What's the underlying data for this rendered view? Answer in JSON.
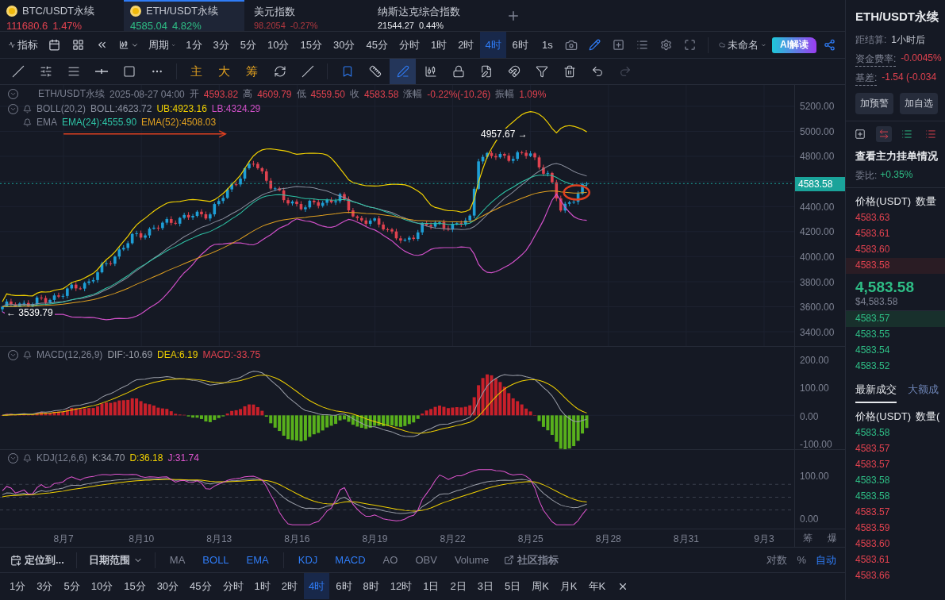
{
  "tabs": [
    {
      "symbol": "BTC/USDT永续",
      "price": "111680.6",
      "change": "1.47%",
      "color": "#e0424f",
      "kind": "crypto",
      "selected": false
    },
    {
      "symbol": "ETH/USDT永续",
      "price": "4585.04",
      "change": "4.82%",
      "color": "#2ebd85",
      "kind": "crypto",
      "selected": true
    },
    {
      "symbol": "美元指数",
      "price": "98.2054",
      "change": "-0.27%",
      "color": "#b0383f",
      "kind": "index",
      "selected": false
    },
    {
      "symbol": "纳斯达克综合指数",
      "price": "21544.27",
      "change": "0.44%",
      "color": "#e6e8ec",
      "kind": "index",
      "selected": false
    }
  ],
  "toolbar": {
    "indicator_label": "指标",
    "period_label": "周期",
    "periods": [
      {
        "label": "1分",
        "selected": false
      },
      {
        "label": "3分",
        "selected": false
      },
      {
        "label": "5分",
        "selected": false
      },
      {
        "label": "10分",
        "selected": false
      },
      {
        "label": "15分",
        "selected": false
      },
      {
        "label": "30分",
        "selected": false
      },
      {
        "label": "45分",
        "selected": false
      },
      {
        "label": "分时",
        "selected": false
      },
      {
        "label": "1时",
        "selected": false
      },
      {
        "label": "2时",
        "selected": false
      },
      {
        "label": "4时",
        "selected": true
      },
      {
        "label": "6时",
        "selected": false
      }
    ],
    "seconds": "1s",
    "layout_name": "未命名",
    "ai_label": "AI解读"
  },
  "drawing_tool_groups": [
    [
      {
        "kind": "trend-line",
        "selected": false
      },
      {
        "kind": "parallel",
        "selected": false
      },
      {
        "kind": "channel",
        "selected": false
      },
      {
        "kind": "horizontal",
        "selected": false
      },
      {
        "kind": "rectangle",
        "selected": false
      },
      {
        "kind": "more",
        "selected": false
      }
    ],
    [
      {
        "kind": "text",
        "label": "主",
        "selected": false
      },
      {
        "kind": "text",
        "label": "大",
        "selected": false
      },
      {
        "kind": "text",
        "label": "筹",
        "selected": false
      },
      {
        "kind": "rotate",
        "selected": false
      },
      {
        "kind": "measure",
        "selected": false
      }
    ],
    [
      {
        "kind": "bookmark",
        "selected": false
      },
      {
        "kind": "ruler",
        "selected": false
      },
      {
        "kind": "pen",
        "selected": true
      },
      {
        "kind": "candles",
        "selected": false
      },
      {
        "kind": "lock",
        "selected": false
      },
      {
        "kind": "edit",
        "selected": false
      },
      {
        "kind": "magnet",
        "selected": false
      },
      {
        "kind": "filter",
        "selected": false
      },
      {
        "kind": "trash",
        "selected": false
      },
      {
        "kind": "undo",
        "selected": false
      },
      {
        "kind": "redo",
        "selected": false
      }
    ]
  ],
  "legend": {
    "symbol": "ETH/USDT永续",
    "time": "2025-08-27 04:00",
    "ohlc": [
      {
        "label": "开",
        "value": "4593.82"
      },
      {
        "label": "高",
        "value": "4609.79"
      },
      {
        "label": "低",
        "value": "4559.50"
      },
      {
        "label": "收",
        "value": "4583.58"
      }
    ],
    "change_label": "涨幅",
    "change": "-0.22%(-10.26)",
    "amplitude_label": "振幅",
    "amplitude": "1.09%"
  },
  "boll": {
    "name": "BOLL(20,2)",
    "values": [
      {
        "text": "BOLL:4623.72",
        "color": "#8a8f9e"
      },
      {
        "text": "UB:4923.16",
        "color": "#f0d000"
      },
      {
        "text": "LB:4324.29",
        "color": "#d050c8"
      }
    ]
  },
  "ema": {
    "name": "EMA",
    "values": [
      {
        "text": "EMA(24):4555.90",
        "color": "#2ec4a6"
      },
      {
        "text": "EMA(52):4508.03",
        "color": "#e0a020"
      }
    ]
  },
  "macd": {
    "name": "MACD(12,26,9)",
    "values": [
      {
        "text": "DIF:-10.69",
        "color": "#9a9ea8"
      },
      {
        "text": "DEA:6.19",
        "color": "#f0d000"
      },
      {
        "text": "MACD:-33.75",
        "color": "#e0424f"
      }
    ]
  },
  "kdj": {
    "name": "KDJ(12,6,6)",
    "values": [
      {
        "text": "K:34.70",
        "color": "#9a9ea8"
      },
      {
        "text": "D:36.18",
        "color": "#f0d000"
      },
      {
        "text": "J:31.74",
        "color": "#e055d0"
      }
    ]
  },
  "price_axis_upper": [
    "5200.00",
    "5000.00",
    "4800.00"
  ],
  "price_axis_lower": [
    "4400.00",
    "4200.00",
    "4000.00",
    "3800.00",
    "3600.00",
    "3400.00"
  ],
  "current_price": "4583.58",
  "high_marker": "4957.67 →",
  "low_marker": "← 3539.79",
  "macd_axis": [
    "200.00",
    "100.00",
    "0.00",
    "-100.00"
  ],
  "kdj_axis": [
    "100.00",
    "0.00"
  ],
  "x_axis": [
    "8月7",
    "8月10",
    "8月13",
    "8月16",
    "8月19",
    "8月22",
    "8月25",
    "8月28",
    "8月31",
    "9月3"
  ],
  "corner_labels": [
    "筹",
    "爆"
  ],
  "bottom_bar": {
    "locate": "定位到...",
    "date_range": "日期范围",
    "main_indicators": [
      {
        "label": "MA",
        "selected": false
      },
      {
        "label": "BOLL",
        "selected": true
      },
      {
        "label": "EMA",
        "selected": true
      }
    ],
    "sub_indicators": [
      {
        "label": "KDJ",
        "selected": true
      },
      {
        "label": "MACD",
        "selected": true
      },
      {
        "label": "AO",
        "selected": false
      },
      {
        "label": "OBV",
        "selected": false
      },
      {
        "label": "Volume",
        "selected": false
      }
    ],
    "community": "社区指标",
    "scale_options": [
      {
        "label": "对数",
        "selected": false
      },
      {
        "label": "%",
        "selected": false
      },
      {
        "label": "自动",
        "selected": true
      }
    ]
  },
  "bottom_periods": [
    {
      "label": "1分",
      "selected": false
    },
    {
      "label": "3分",
      "selected": false
    },
    {
      "label": "5分",
      "selected": false
    },
    {
      "label": "10分",
      "selected": false
    },
    {
      "label": "15分",
      "selected": false
    },
    {
      "label": "30分",
      "selected": false
    },
    {
      "label": "45分",
      "selected": false
    },
    {
      "label": "分时",
      "selected": false
    },
    {
      "label": "1时",
      "selected": false
    },
    {
      "label": "2时",
      "selected": false
    },
    {
      "label": "4时",
      "selected": true
    },
    {
      "label": "6时",
      "selected": false
    },
    {
      "label": "8时",
      "selected": false
    },
    {
      "label": "12时",
      "selected": false
    },
    {
      "label": "1日",
      "selected": false
    },
    {
      "label": "2日",
      "selected": false
    },
    {
      "label": "3日",
      "selected": false
    },
    {
      "label": "5日",
      "selected": false
    },
    {
      "label": "周K",
      "selected": false
    },
    {
      "label": "月K",
      "selected": false
    },
    {
      "label": "年K",
      "selected": false
    }
  ],
  "side_panel": {
    "title": "ETH/USDT永续",
    "info": [
      {
        "label": "距结算:",
        "value": "1小时后",
        "underlined": false,
        "color": "#c6cad3"
      },
      {
        "label": "资金费率:",
        "value": "-0.0045%",
        "underlined": true,
        "color": "#e0424f"
      },
      {
        "label": "基差:",
        "value": "-1.54 (-0.034",
        "underlined": true,
        "color": "#e0424f"
      }
    ],
    "buttons": [
      "加预警",
      "加自选"
    ],
    "view_tabs": [
      {
        "kind": "add",
        "selected": false
      },
      {
        "kind": "both",
        "selected": true
      },
      {
        "kind": "bids",
        "selected": false
      },
      {
        "kind": "asks",
        "selected": false
      }
    ],
    "depth_title": "查看主力挂单情况",
    "ratio_label": "委比:",
    "ratio": "+0.35%",
    "book_header": [
      "价格(USDT)",
      "数量"
    ],
    "asks": [
      {
        "price": "4583.63",
        "highlighted": false
      },
      {
        "price": "4583.61",
        "highlighted": false
      },
      {
        "price": "4583.60",
        "highlighted": false
      },
      {
        "price": "4583.58",
        "highlighted": true
      }
    ],
    "last_price": "4,583.58",
    "last_price_usd": "$4,583.58",
    "bids": [
      {
        "price": "4583.57",
        "highlighted": true
      },
      {
        "price": "4583.55",
        "highlighted": false
      },
      {
        "price": "4583.54",
        "highlighted": false
      },
      {
        "price": "4583.52",
        "highlighted": false
      }
    ],
    "trade_tabs": [
      {
        "label": "最新成交",
        "selected": true
      },
      {
        "label": "大额成",
        "selected": false
      }
    ],
    "trade_header": [
      "价格(USDT)",
      "数量("
    ],
    "trades": [
      {
        "price": "4583.58",
        "color": "#2ebd85"
      },
      {
        "price": "4583.57",
        "color": "#e0424f"
      },
      {
        "price": "4583.57",
        "color": "#e0424f"
      },
      {
        "price": "4583.58",
        "color": "#2ebd85"
      },
      {
        "price": "4583.58",
        "color": "#2ebd85"
      },
      {
        "price": "4583.57",
        "color": "#e0424f"
      },
      {
        "price": "4583.59",
        "color": "#e0424f"
      },
      {
        "price": "4583.60",
        "color": "#e0424f"
      },
      {
        "price": "4583.61",
        "color": "#e0424f"
      },
      {
        "price": "4583.66",
        "color": "#e0424f"
      }
    ]
  }
}
